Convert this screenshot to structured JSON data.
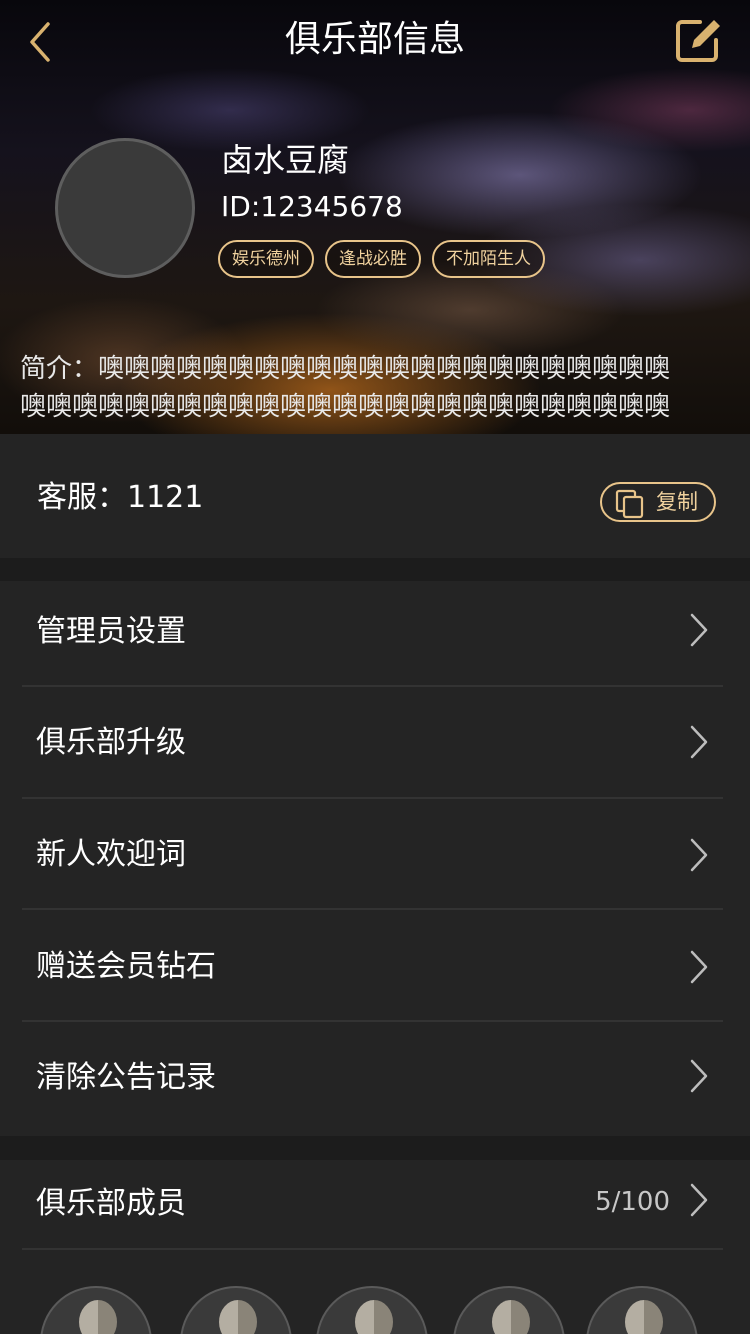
{
  "header": {
    "title": "俱乐部信息"
  },
  "club": {
    "name": "卤水豆腐",
    "id_text": "ID:12345678",
    "tags": [
      "娱乐德州",
      "逢战必胜",
      "不加陌生人"
    ],
    "intro_line1": "简介：噢噢噢噢噢噢噢噢噢噢噢噢噢噢噢噢噢噢噢噢噢噢",
    "intro_line2": "噢噢噢噢噢噢噢噢噢噢噢噢噢噢噢噢噢噢噢噢噢噢噢噢噢"
  },
  "service": {
    "label": "客服：1121",
    "copy_label": "复制"
  },
  "menu": {
    "items": [
      {
        "label": "管理员设置"
      },
      {
        "label": "俱乐部升级"
      },
      {
        "label": "新人欢迎词"
      },
      {
        "label": "赠送会员钻石"
      },
      {
        "label": "清除公告记录"
      }
    ]
  },
  "members": {
    "label": "俱乐部成员",
    "count": "5/100"
  },
  "colors": {
    "accent_gold": "#e8c48a",
    "background": "#1c1c1c",
    "panel": "#242424"
  },
  "icons": [
    "back-icon",
    "edit-icon",
    "copy-icon",
    "chevron-right-icon",
    "default-avatar-icon"
  ]
}
